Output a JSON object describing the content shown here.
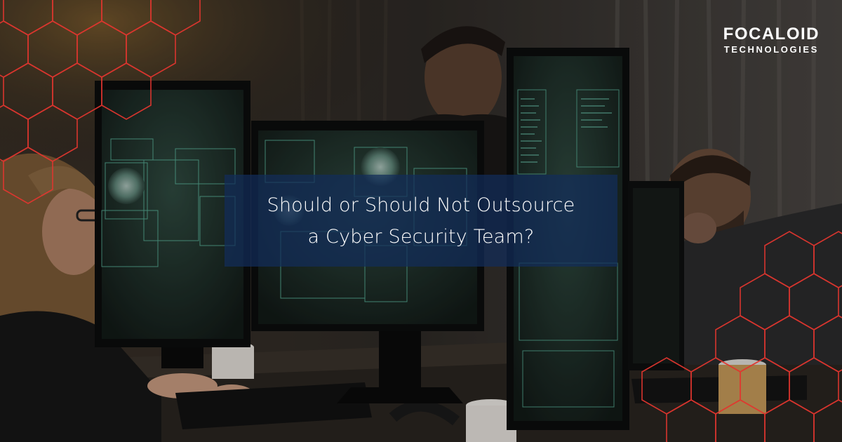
{
  "brand": {
    "name": "FOCALOID",
    "tagline": "TECHNOLOGIES",
    "accent_color": "#e2362f"
  },
  "headline": {
    "line1": "Should or Should Not Outsource",
    "line2": "a Cyber Security Team?",
    "box_color": "#1b3a78"
  },
  "decorations": [
    "hexagon-mesh-top-left",
    "hexagon-mesh-bottom-right"
  ]
}
